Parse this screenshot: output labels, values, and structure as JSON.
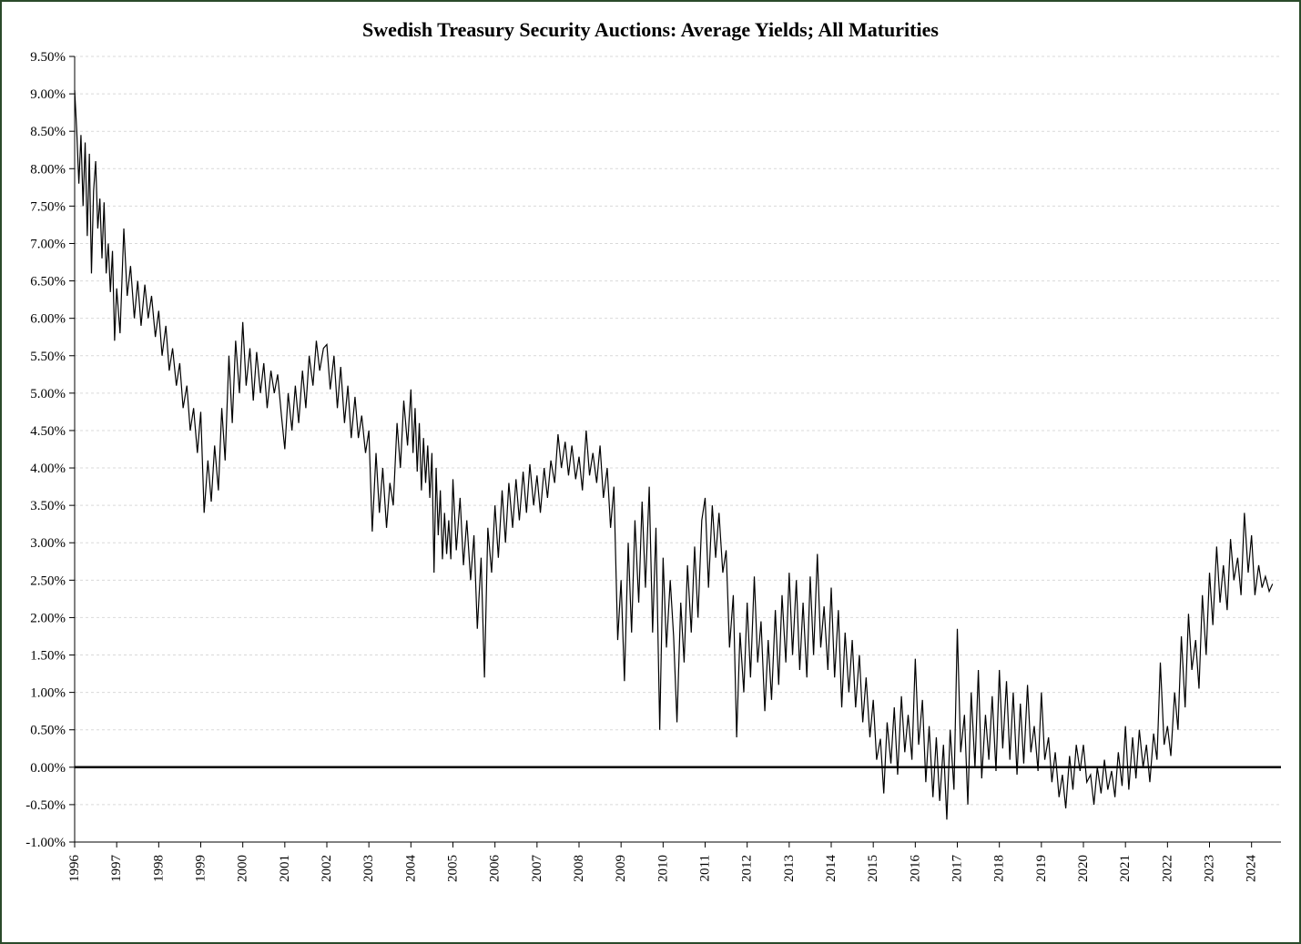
{
  "chart_data": {
    "type": "line",
    "title": "Swedish Treasury Security Auctions: Average Yields; All Maturities",
    "xlabel": "",
    "ylabel": "",
    "ylim": [
      -1.0,
      9.5
    ],
    "y_ticks": [
      -1.0,
      -0.5,
      0.0,
      0.5,
      1.0,
      1.5,
      2.0,
      2.5,
      3.0,
      3.5,
      4.0,
      4.5,
      5.0,
      5.5,
      6.0,
      6.5,
      7.0,
      7.5,
      8.0,
      8.5,
      9.0,
      9.5
    ],
    "y_tick_labels": [
      "-1.00%",
      "-0.50%",
      "0.00%",
      "0.50%",
      "1.00%",
      "1.50%",
      "2.00%",
      "2.50%",
      "3.00%",
      "3.50%",
      "4.00%",
      "4.50%",
      "5.00%",
      "5.50%",
      "6.00%",
      "6.50%",
      "7.00%",
      "7.50%",
      "8.00%",
      "8.50%",
      "9.00%",
      "9.50%"
    ],
    "xlim": [
      1996.0,
      2024.7
    ],
    "x_ticks": [
      1996,
      1997,
      1998,
      1999,
      2000,
      2001,
      2002,
      2003,
      2004,
      2005,
      2006,
      2007,
      2008,
      2009,
      2010,
      2011,
      2012,
      2013,
      2014,
      2015,
      2016,
      2017,
      2018,
      2019,
      2020,
      2021,
      2022,
      2023,
      2024
    ],
    "x_tick_labels": [
      "1996",
      "1997",
      "1998",
      "1999",
      "2000",
      "2001",
      "2002",
      "2003",
      "2004",
      "2005",
      "2006",
      "2007",
      "2008",
      "2009",
      "2010",
      "2011",
      "2012",
      "2013",
      "2014",
      "2015",
      "2016",
      "2017",
      "2018",
      "2019",
      "2020",
      "2021",
      "2022",
      "2023",
      "2024"
    ],
    "series": [
      {
        "name": "Average Yield",
        "x": [
          1996.0,
          1996.05,
          1996.1,
          1996.15,
          1996.2,
          1996.25,
          1996.3,
          1996.35,
          1996.4,
          1996.45,
          1996.5,
          1996.55,
          1996.6,
          1996.65,
          1996.7,
          1996.75,
          1996.8,
          1996.85,
          1996.9,
          1996.95,
          1997.0,
          1997.08,
          1997.17,
          1997.25,
          1997.33,
          1997.42,
          1997.5,
          1997.58,
          1997.67,
          1997.75,
          1997.83,
          1997.92,
          1998.0,
          1998.08,
          1998.17,
          1998.25,
          1998.33,
          1998.42,
          1998.5,
          1998.58,
          1998.67,
          1998.75,
          1998.83,
          1998.92,
          1999.0,
          1999.08,
          1999.17,
          1999.25,
          1999.33,
          1999.42,
          1999.5,
          1999.58,
          1999.67,
          1999.75,
          1999.83,
          1999.92,
          2000.0,
          2000.08,
          2000.17,
          2000.25,
          2000.33,
          2000.42,
          2000.5,
          2000.58,
          2000.67,
          2000.75,
          2000.83,
          2000.92,
          2001.0,
          2001.08,
          2001.17,
          2001.25,
          2001.33,
          2001.42,
          2001.5,
          2001.58,
          2001.67,
          2001.75,
          2001.83,
          2001.92,
          2002.0,
          2002.08,
          2002.17,
          2002.25,
          2002.33,
          2002.42,
          2002.5,
          2002.58,
          2002.67,
          2002.75,
          2002.83,
          2002.92,
          2003.0,
          2003.08,
          2003.17,
          2003.25,
          2003.33,
          2003.42,
          2003.5,
          2003.58,
          2003.67,
          2003.75,
          2003.83,
          2003.92,
          2004.0,
          2004.05,
          2004.1,
          2004.15,
          2004.2,
          2004.25,
          2004.3,
          2004.35,
          2004.4,
          2004.45,
          2004.5,
          2004.55,
          2004.6,
          2004.65,
          2004.7,
          2004.75,
          2004.8,
          2004.85,
          2004.9,
          2004.95,
          2005.0,
          2005.08,
          2005.17,
          2005.25,
          2005.33,
          2005.42,
          2005.5,
          2005.58,
          2005.67,
          2005.75,
          2005.83,
          2005.92,
          2006.0,
          2006.08,
          2006.17,
          2006.25,
          2006.33,
          2006.42,
          2006.5,
          2006.58,
          2006.67,
          2006.75,
          2006.83,
          2006.92,
          2007.0,
          2007.08,
          2007.17,
          2007.25,
          2007.33,
          2007.42,
          2007.5,
          2007.58,
          2007.67,
          2007.75,
          2007.83,
          2007.92,
          2008.0,
          2008.08,
          2008.17,
          2008.25,
          2008.33,
          2008.42,
          2008.5,
          2008.58,
          2008.67,
          2008.75,
          2008.83,
          2008.92,
          2009.0,
          2009.08,
          2009.17,
          2009.25,
          2009.33,
          2009.42,
          2009.5,
          2009.58,
          2009.67,
          2009.75,
          2009.83,
          2009.92,
          2010.0,
          2010.08,
          2010.17,
          2010.25,
          2010.33,
          2010.42,
          2010.5,
          2010.58,
          2010.67,
          2010.75,
          2010.83,
          2010.92,
          2011.0,
          2011.08,
          2011.17,
          2011.25,
          2011.33,
          2011.42,
          2011.5,
          2011.58,
          2011.67,
          2011.75,
          2011.83,
          2011.92,
          2012.0,
          2012.08,
          2012.17,
          2012.25,
          2012.33,
          2012.42,
          2012.5,
          2012.58,
          2012.67,
          2012.75,
          2012.83,
          2012.92,
          2013.0,
          2013.08,
          2013.17,
          2013.25,
          2013.33,
          2013.42,
          2013.5,
          2013.58,
          2013.67,
          2013.75,
          2013.83,
          2013.92,
          2014.0,
          2014.08,
          2014.17,
          2014.25,
          2014.33,
          2014.42,
          2014.5,
          2014.58,
          2014.67,
          2014.75,
          2014.83,
          2014.92,
          2015.0,
          2015.08,
          2015.17,
          2015.25,
          2015.33,
          2015.42,
          2015.5,
          2015.58,
          2015.67,
          2015.75,
          2015.83,
          2015.92,
          2016.0,
          2016.08,
          2016.17,
          2016.25,
          2016.33,
          2016.42,
          2016.5,
          2016.58,
          2016.67,
          2016.75,
          2016.83,
          2016.92,
          2017.0,
          2017.08,
          2017.17,
          2017.25,
          2017.33,
          2017.42,
          2017.5,
          2017.58,
          2017.67,
          2017.75,
          2017.83,
          2017.92,
          2018.0,
          2018.08,
          2018.17,
          2018.25,
          2018.33,
          2018.42,
          2018.5,
          2018.58,
          2018.67,
          2018.75,
          2018.83,
          2018.92,
          2019.0,
          2019.08,
          2019.17,
          2019.25,
          2019.33,
          2019.42,
          2019.5,
          2019.58,
          2019.67,
          2019.75,
          2019.83,
          2019.92,
          2020.0,
          2020.08,
          2020.17,
          2020.25,
          2020.33,
          2020.42,
          2020.5,
          2020.58,
          2020.67,
          2020.75,
          2020.83,
          2020.92,
          2021.0,
          2021.08,
          2021.17,
          2021.25,
          2021.33,
          2021.42,
          2021.5,
          2021.58,
          2021.67,
          2021.75,
          2021.83,
          2021.92,
          2022.0,
          2022.08,
          2022.17,
          2022.25,
          2022.33,
          2022.42,
          2022.5,
          2022.58,
          2022.67,
          2022.75,
          2022.83,
          2022.92,
          2023.0,
          2023.08,
          2023.17,
          2023.25,
          2023.33,
          2023.42,
          2023.5,
          2023.58,
          2023.67,
          2023.75,
          2023.83,
          2023.92,
          2024.0,
          2024.08,
          2024.17,
          2024.25,
          2024.33,
          2024.42,
          2024.5
        ],
        "values": [
          9.05,
          8.5,
          7.8,
          8.45,
          7.5,
          8.35,
          7.1,
          8.2,
          6.6,
          7.7,
          8.1,
          7.2,
          7.6,
          6.8,
          7.55,
          6.6,
          7.0,
          6.35,
          6.9,
          5.7,
          6.4,
          5.8,
          7.2,
          6.3,
          6.7,
          6.0,
          6.5,
          5.9,
          6.45,
          6.0,
          6.3,
          5.75,
          6.1,
          5.5,
          5.9,
          5.3,
          5.6,
          5.1,
          5.4,
          4.8,
          5.1,
          4.5,
          4.8,
          4.2,
          4.75,
          3.4,
          4.1,
          3.55,
          4.3,
          3.7,
          4.8,
          4.1,
          5.5,
          4.6,
          5.7,
          5.0,
          5.95,
          5.1,
          5.6,
          4.9,
          5.55,
          5.0,
          5.4,
          4.8,
          5.3,
          5.0,
          5.25,
          4.7,
          4.25,
          5.0,
          4.5,
          5.1,
          4.6,
          5.3,
          4.8,
          5.5,
          5.1,
          5.7,
          5.3,
          5.6,
          5.65,
          5.05,
          5.5,
          4.8,
          5.35,
          4.6,
          5.1,
          4.4,
          4.95,
          4.4,
          4.7,
          4.2,
          4.5,
          3.15,
          4.2,
          3.4,
          4.0,
          3.2,
          3.8,
          3.5,
          4.6,
          4.0,
          4.9,
          4.3,
          5.05,
          4.2,
          4.8,
          3.95,
          4.6,
          3.7,
          4.4,
          3.8,
          4.3,
          3.6,
          4.2,
          2.6,
          4.0,
          3.1,
          3.7,
          2.78,
          3.4,
          2.85,
          3.3,
          2.78,
          3.85,
          2.9,
          3.6,
          2.7,
          3.3,
          2.5,
          3.1,
          1.85,
          2.8,
          1.2,
          3.2,
          2.6,
          3.5,
          2.8,
          3.7,
          3.0,
          3.8,
          3.2,
          3.85,
          3.3,
          3.95,
          3.4,
          4.05,
          3.5,
          3.9,
          3.4,
          4.0,
          3.6,
          4.1,
          3.8,
          4.45,
          4.0,
          4.35,
          3.9,
          4.3,
          3.85,
          4.15,
          3.7,
          4.5,
          3.9,
          4.2,
          3.8,
          4.3,
          3.6,
          4.0,
          3.2,
          3.75,
          1.7,
          2.5,
          1.15,
          3.0,
          1.8,
          3.3,
          2.2,
          3.55,
          2.4,
          3.75,
          1.8,
          3.2,
          0.5,
          2.8,
          1.6,
          2.5,
          1.75,
          0.6,
          2.2,
          1.4,
          2.7,
          1.8,
          2.95,
          2.0,
          3.3,
          3.6,
          2.4,
          3.5,
          2.8,
          3.4,
          2.6,
          2.9,
          1.6,
          2.3,
          0.4,
          1.8,
          1.0,
          2.2,
          1.2,
          2.55,
          1.4,
          1.95,
          0.75,
          1.7,
          0.9,
          2.1,
          1.1,
          2.3,
          1.4,
          2.6,
          1.5,
          2.5,
          1.3,
          2.2,
          1.2,
          2.55,
          1.5,
          2.85,
          1.6,
          2.15,
          1.3,
          2.4,
          1.2,
          2.1,
          0.8,
          1.8,
          1.0,
          1.7,
          0.8,
          1.5,
          0.6,
          1.2,
          0.4,
          0.9,
          0.1,
          0.38,
          -0.35,
          0.6,
          0.05,
          0.8,
          -0.1,
          0.95,
          0.2,
          0.7,
          0.1,
          1.45,
          0.3,
          0.9,
          -0.2,
          0.55,
          -0.4,
          0.4,
          -0.45,
          0.3,
          -0.7,
          0.5,
          -0.3,
          1.85,
          0.2,
          0.7,
          -0.5,
          1.0,
          0.0,
          1.3,
          -0.15,
          0.7,
          0.1,
          0.95,
          -0.05,
          1.3,
          0.25,
          1.15,
          0.1,
          1.0,
          -0.1,
          0.85,
          0.05,
          1.1,
          0.2,
          0.55,
          -0.05,
          1.0,
          0.1,
          0.4,
          -0.2,
          0.2,
          -0.4,
          -0.1,
          -0.55,
          0.15,
          -0.3,
          0.3,
          -0.05,
          0.3,
          -0.2,
          -0.1,
          -0.5,
          0.0,
          -0.35,
          0.1,
          -0.3,
          -0.05,
          -0.4,
          0.2,
          -0.25,
          0.55,
          -0.3,
          0.4,
          -0.15,
          0.5,
          0.0,
          0.3,
          -0.2,
          0.45,
          0.1,
          1.4,
          0.3,
          0.55,
          0.15,
          1.0,
          0.5,
          1.75,
          0.8,
          2.05,
          1.3,
          1.7,
          1.05,
          2.3,
          1.5,
          2.6,
          1.9,
          2.95,
          2.2,
          2.7,
          2.1,
          3.05,
          2.5,
          2.8,
          2.3,
          3.4,
          2.6,
          3.1,
          2.3,
          2.7,
          2.4,
          2.55,
          2.35,
          2.45
        ]
      }
    ]
  }
}
